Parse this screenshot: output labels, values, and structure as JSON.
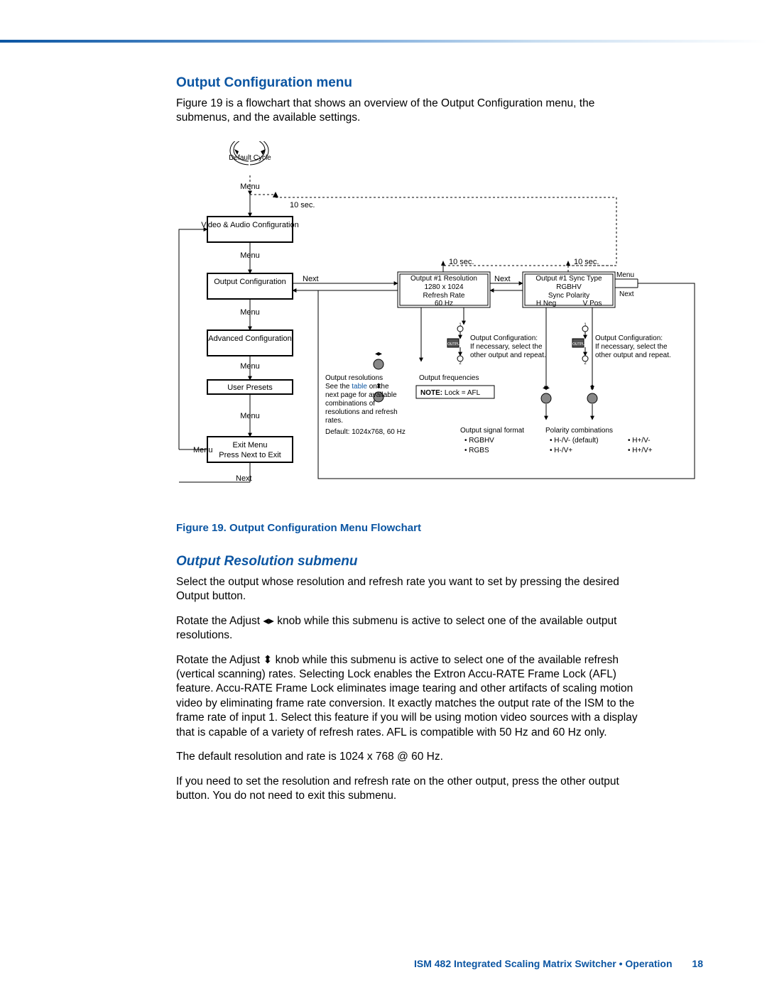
{
  "heading_section": "Output Configuration menu",
  "para_intro": "Figure 19 is a flowchart that shows an overview of the Output Configuration menu, the submenus, and the available settings.",
  "fig": {
    "caption": "Figure 19.   Output Configuration Menu Flowchart",
    "default_cycle": "Default Cycle",
    "menu_label": "Menu",
    "next_label": "Next",
    "ten_sec": "10 sec.",
    "boxes": {
      "va_config": "Video & Audio Configuration",
      "out_config": "Output Configuration",
      "adv_config": "Advanced Configuration",
      "user_presets": "User  Presets",
      "exit_menu_line1": "Exit Menu",
      "exit_menu_line2": "Press Next to Exit",
      "out1_res_l1": "Output #1 Resolution",
      "out1_res_l2": "1280 x 1024",
      "out1_res_l3": "Refresh Rate",
      "out1_res_l4": "60 Hz",
      "out1_sync_l1": "Output #1 Sync Type",
      "out1_sync_l2": "RGBHV",
      "out1_sync_l3": "Sync Polarity",
      "out1_sync_l4a": "H Neg",
      "out1_sync_l4b": "V Pos"
    },
    "notes": {
      "out_res_title": "Output resolutions",
      "out_res_prefix": "See the ",
      "out_res_link": "table",
      "out_res_suffix": " on the next page for available combinations of resolutions and refresh rates.",
      "out_res_default": "Default: 1024x768, 60 Hz",
      "out_freq_title": "Output frequencies",
      "note_lock_prefix": "NOTE:",
      "note_lock_body": "  Lock = AFL",
      "out_cfg_title": "Output Configuration:",
      "out_cfg_body": "If necessary, select the other output and repeat.",
      "outputs_label": "OUTPUTS",
      "sig_fmt_title": "Output signal format",
      "sig_fmt_items": [
        "RGBHV",
        "RGBS"
      ],
      "pol_title": "Polarity combinations",
      "pol_items": [
        "H-/V- (default)",
        "H-/V+",
        "H+/V-",
        "H+/V+"
      ]
    }
  },
  "heading_sub": "Output Resolution submenu",
  "para_sub1": "Select the output whose resolution and refresh rate you want to set by pressing the desired Output button.",
  "para_sub2_a": "Rotate the Adjust ",
  "para_sub2_b": " knob while this submenu is active to select one of the available output resolutions.",
  "para_sub3_a": "Rotate the Adjust ",
  "para_sub3_b": " knob while this submenu is active to select one of the available refresh (vertical scanning) rates.  Selecting Lock enables the Extron Accu-RATE Frame Lock (AFL) feature.  Accu-RATE Frame Lock eliminates image tearing and other artifacts of scaling motion video by eliminating frame rate conversion.  It exactly matches the output rate of the ISM to the frame rate of input 1.  Select this feature if you will be using motion video sources with a display that is capable of a variety of refresh rates.  AFL is compatible with 50 Hz and 60 Hz only.",
  "para_sub4": "The default resolution and rate is 1024 x 768 @ 60 Hz.",
  "para_sub5": "If you need to set the resolution and refresh rate on the other output, press the other output button.  You do not need to exit this submenu.",
  "footer_title": "ISM 482 Integrated Scaling Matrix Switcher  •  Operation",
  "footer_page": "18",
  "glyphs": {
    "lr_arrows": "◂▸",
    "ud_arrows": "⬍"
  }
}
